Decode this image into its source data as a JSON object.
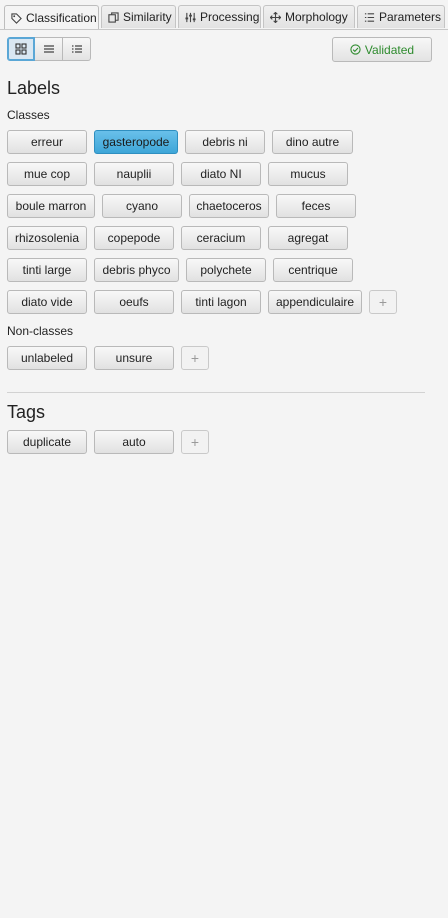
{
  "tabs": [
    {
      "label": "Classification",
      "icon": "tag-icon",
      "active": true
    },
    {
      "label": "Similarity",
      "icon": "copy-icon",
      "active": false
    },
    {
      "label": "Processing",
      "icon": "sliders-icon",
      "active": false
    },
    {
      "label": "Morphology",
      "icon": "move-icon",
      "active": false
    },
    {
      "label": "Parameters",
      "icon": "list-icon",
      "active": false
    }
  ],
  "view_modes": [
    "grid-view",
    "list-view",
    "detail-list-view"
  ],
  "validated_label": "Validated",
  "labels_heading": "Labels",
  "classes_heading": "Classes",
  "classes": [
    [
      "erreur",
      "gasteropode",
      "debris ni",
      "dino autre"
    ],
    [
      "mue cop",
      "nauplii",
      "diato NI",
      "mucus"
    ],
    [
      "boule marron",
      "cyano",
      "chaetoceros",
      "feces"
    ],
    [
      "rhizosolenia",
      "copepode",
      "ceracium",
      "agregat"
    ],
    [
      "tinti large",
      "debris phyco",
      "polychete",
      "centrique"
    ],
    [
      "diato vide",
      "oeufs",
      "tinti lagon",
      "appendiculaire"
    ]
  ],
  "selected_class": "gasteropode",
  "nonclasses_heading": "Non-classes",
  "nonclasses": [
    "unlabeled",
    "unsure"
  ],
  "tags_heading": "Tags",
  "tags": [
    "duplicate",
    "auto"
  ],
  "colors": {
    "accent": "#48aee0",
    "validated": "#2e8b2e"
  }
}
